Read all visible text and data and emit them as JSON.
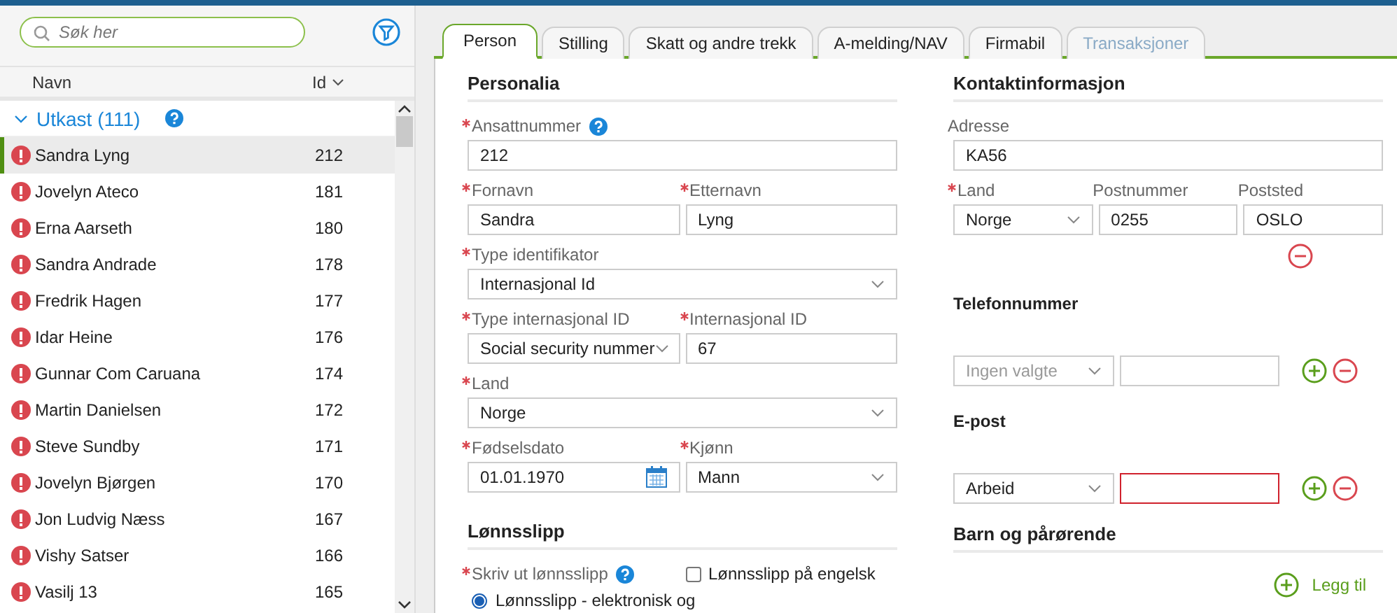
{
  "search": {
    "placeholder": "Søk her"
  },
  "list": {
    "columns": [
      {
        "label": "Navn",
        "sorted": false
      },
      {
        "label": "Id",
        "sorted": true
      }
    ],
    "group": {
      "label": "Utkast (111)",
      "expanded": true
    },
    "rows": [
      {
        "name": "Sandra Lyng",
        "id": "212",
        "selected": true,
        "warning": true
      },
      {
        "name": "Jovelyn Ateco",
        "id": "181",
        "selected": false,
        "warning": true
      },
      {
        "name": "Erna Aarseth",
        "id": "180",
        "selected": false,
        "warning": true
      },
      {
        "name": "Sandra Andrade",
        "id": "178",
        "selected": false,
        "warning": true
      },
      {
        "name": "Fredrik Hagen",
        "id": "177",
        "selected": false,
        "warning": true
      },
      {
        "name": "Idar Heine",
        "id": "176",
        "selected": false,
        "warning": true
      },
      {
        "name": "Gunnar Com Caruana",
        "id": "174",
        "selected": false,
        "warning": true
      },
      {
        "name": "Martin Danielsen",
        "id": "172",
        "selected": false,
        "warning": true
      },
      {
        "name": "Steve Sundby",
        "id": "171",
        "selected": false,
        "warning": true
      },
      {
        "name": "Jovelyn Bjørgen",
        "id": "170",
        "selected": false,
        "warning": true
      },
      {
        "name": "Jon Ludvig Næss",
        "id": "167",
        "selected": false,
        "warning": true
      },
      {
        "name": "Vishy Satser",
        "id": "166",
        "selected": false,
        "warning": true
      },
      {
        "name": "Vasilj 13",
        "id": "165",
        "selected": false,
        "warning": true
      }
    ]
  },
  "tabs": [
    {
      "label": "Person",
      "selected": true,
      "disabled": false
    },
    {
      "label": "Stilling",
      "selected": false,
      "disabled": false
    },
    {
      "label": "Skatt og andre trekk",
      "selected": false,
      "disabled": false
    },
    {
      "label": "A-melding/NAV",
      "selected": false,
      "disabled": false
    },
    {
      "label": "Firmabil",
      "selected": false,
      "disabled": false
    },
    {
      "label": "Transaksjoner",
      "selected": false,
      "disabled": true
    }
  ],
  "personalia": {
    "title": "Personalia",
    "rows": [
      [
        {
          "kind": "text",
          "label": "Ansattnummer",
          "required": true,
          "help": true,
          "value": "212"
        }
      ],
      [
        {
          "kind": "text",
          "label": "Fornavn",
          "required": true,
          "help": false,
          "value": "Sandra"
        },
        {
          "kind": "text",
          "label": "Etternavn",
          "required": true,
          "help": false,
          "value": "Lyng"
        }
      ],
      [
        {
          "kind": "select",
          "label": "Type identifikator",
          "required": true,
          "help": false,
          "value": "Internasjonal Id"
        }
      ],
      [
        {
          "kind": "select",
          "label": "Type internasjonal ID",
          "required": true,
          "help": false,
          "value": "Social security nummer"
        },
        {
          "kind": "text",
          "label": "Internasjonal ID",
          "required": true,
          "help": false,
          "value": "67"
        }
      ],
      [
        {
          "kind": "select",
          "label": "Land",
          "required": true,
          "help": false,
          "value": "Norge"
        }
      ],
      [
        {
          "kind": "date",
          "label": "Fødselsdato",
          "required": true,
          "help": false,
          "value": "01.01.1970"
        },
        {
          "kind": "select",
          "label": "Kjønn",
          "required": true,
          "help": false,
          "value": "Mann"
        }
      ]
    ]
  },
  "payslip": {
    "title": "Lønnsslipp",
    "label": "Skriv ut lønnsslipp",
    "required": true,
    "help": true,
    "checkbox": {
      "label": "Lønnsslipp på engelsk",
      "checked": false
    },
    "radio": {
      "label": "Lønnsslipp - elektronisk og",
      "selected": true
    }
  },
  "contact": {
    "title": "Kontaktinformasjon",
    "rows": [
      [
        {
          "kind": "text",
          "label": "Adresse",
          "required": false,
          "help": false,
          "value": "KA56"
        }
      ],
      [
        {
          "kind": "select",
          "label": "Land",
          "required": true,
          "help": false,
          "value": "Norge"
        },
        {
          "kind": "text",
          "label": "Postnummer",
          "required": false,
          "help": false,
          "value": "0255"
        },
        {
          "kind": "text",
          "label": "Poststed",
          "required": false,
          "help": false,
          "value": "OSLO"
        }
      ]
    ]
  },
  "phone": {
    "title": "Telefonnummer",
    "entries": [
      {
        "type_placeholder": "Ingen valgte",
        "invalid": false
      }
    ]
  },
  "email": {
    "title": "E-post",
    "entries": [
      {
        "type": "Arbeid",
        "invalid": true
      }
    ]
  },
  "relatives": {
    "title": "Barn og pårørende",
    "add_label": "Legg til"
  }
}
